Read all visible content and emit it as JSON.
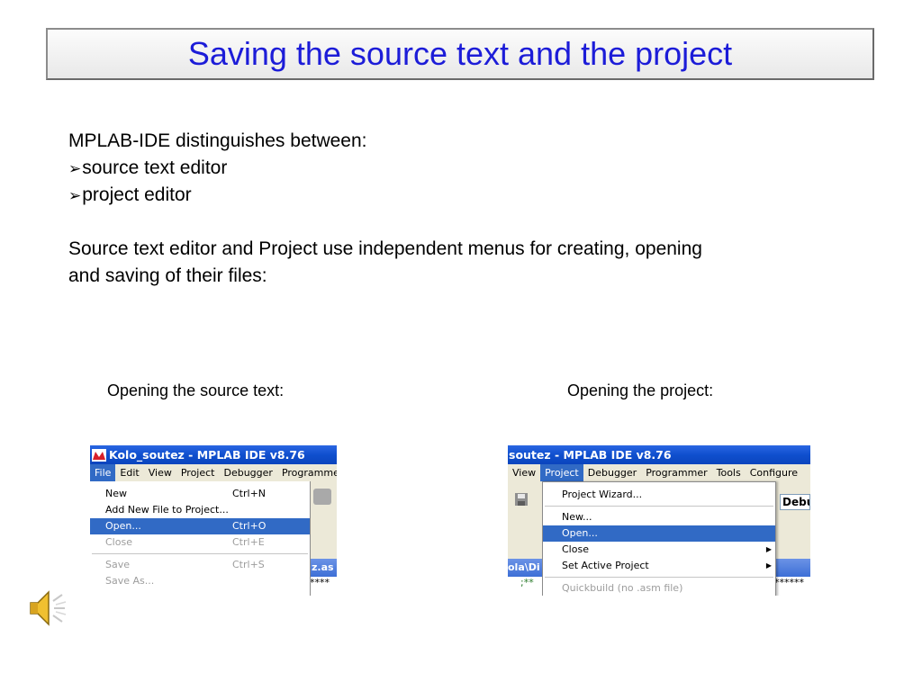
{
  "slide": {
    "title": "Saving the source text and the project",
    "intro": "MPLAB-IDE distinguishes between:",
    "bullet_glyph": "➢",
    "bullets": [
      "source text editor",
      "project editor"
    ],
    "para_line1": "Source text editor and Project use independent menus for creating, opening",
    "para_line2": "and saving of their files:",
    "caption_left": "Opening the source text:",
    "caption_right": "Opening the project:"
  },
  "left_shot": {
    "window_title": "Kolo_soutez - MPLAB IDE v8.76",
    "menu": [
      "File",
      "Edit",
      "View",
      "Project",
      "Debugger",
      "Programmer"
    ],
    "active_menu": "File",
    "items": [
      {
        "label": "New",
        "shortcut": "Ctrl+N",
        "state": "normal"
      },
      {
        "label": "Add New File to Project...",
        "shortcut": "",
        "state": "normal"
      },
      {
        "label": "Open...",
        "shortcut": "Ctrl+O",
        "state": "highlight"
      },
      {
        "label": "Close",
        "shortcut": "Ctrl+E",
        "state": "disabled"
      },
      {
        "label": "Save",
        "shortcut": "Ctrl+S",
        "state": "disabled"
      },
      {
        "label": "Save As...",
        "shortcut": "",
        "state": "disabled"
      }
    ],
    "file_tab_fragment": "z.as",
    "code_fragment": "****"
  },
  "right_shot": {
    "window_title": "soutez - MPLAB IDE v8.76",
    "menu": [
      "View",
      "Project",
      "Debugger",
      "Programmer",
      "Tools",
      "Configure"
    ],
    "active_menu": "Project",
    "items": [
      {
        "label": "Project Wizard...",
        "state": "normal"
      },
      {
        "label": "New...",
        "state": "normal"
      },
      {
        "label": "Open...",
        "state": "highlight"
      },
      {
        "label": "Close",
        "state": "normal"
      },
      {
        "label": "Set Active Project",
        "state": "normal"
      },
      {
        "label": "Quickbuild (no .asm file)",
        "state": "disabled"
      }
    ],
    "build_config_fragment": "Debu",
    "path_fragment": "ola\\Di",
    "code_fragment_left": ";**",
    "code_fragment_right": "******"
  },
  "colors": {
    "title_text": "#1c1cd8",
    "xp_title": "#0f4fce",
    "menu_bg": "#ece9d8",
    "highlight": "#316ac5"
  },
  "icons": {
    "speaker": "speaker-icon",
    "mplab_logo": "mplab-logo-icon",
    "save": "save-icon",
    "submenu_arrow": "submenu-arrow-icon"
  }
}
